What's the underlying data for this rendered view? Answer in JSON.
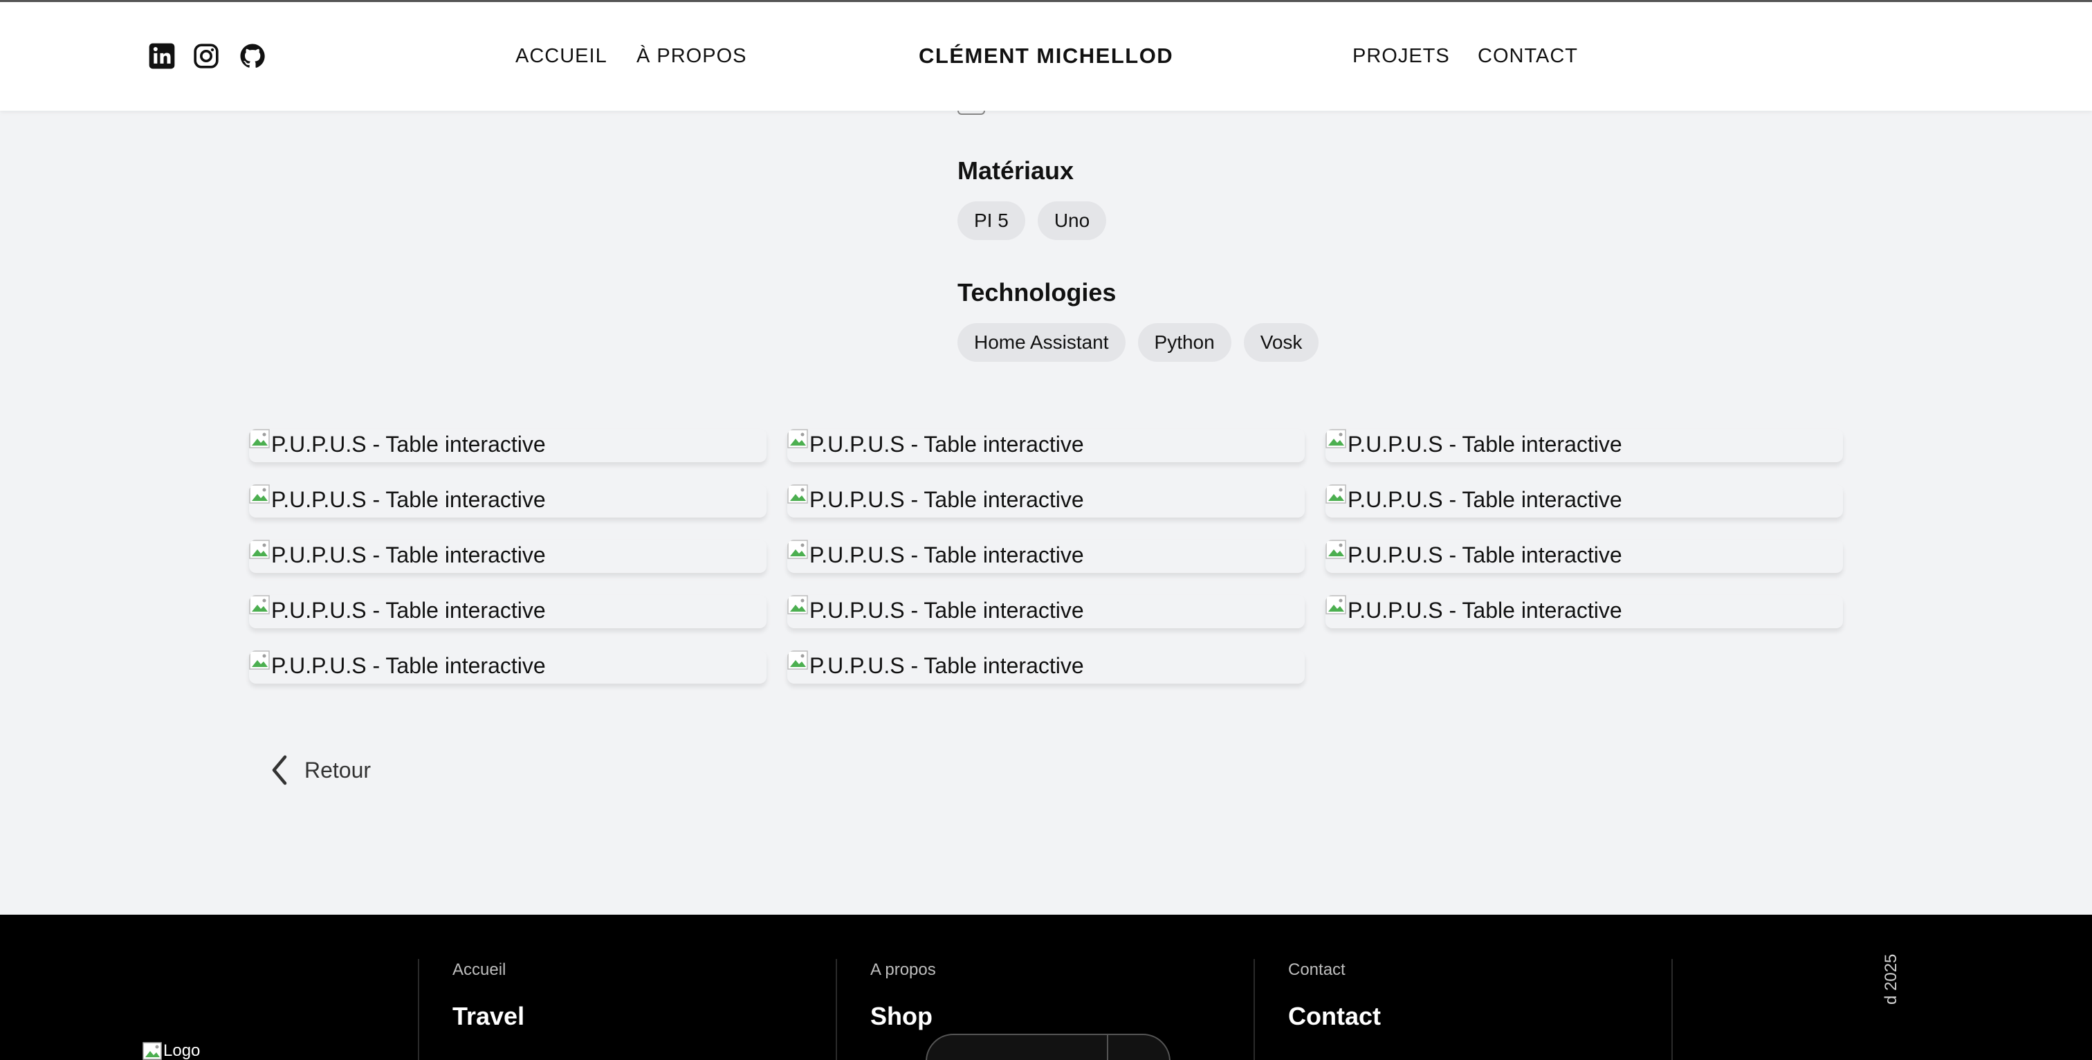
{
  "header": {
    "social": [
      {
        "name": "linkedin-icon"
      },
      {
        "name": "instagram-icon"
      },
      {
        "name": "github-icon"
      }
    ],
    "nav_left": [
      "ACCUEIL",
      "À PROPOS"
    ],
    "brand": "CLÉMENT MICHELLOD",
    "nav_right": [
      "PROJETS",
      "CONTACT"
    ]
  },
  "materials": {
    "title": "Matériaux",
    "chips": [
      "PI 5",
      "Uno"
    ]
  },
  "technologies": {
    "title": "Technologies",
    "chips": [
      "Home Assistant",
      "Python",
      "Vosk"
    ]
  },
  "gallery": {
    "items": [
      "P.U.P.U.S - Table interactive",
      "P.U.P.U.S - Table interactive",
      "P.U.P.U.S - Table interactive",
      "P.U.P.U.S - Table interactive",
      "P.U.P.U.S - Table interactive",
      "P.U.P.U.S - Table interactive",
      "P.U.P.U.S - Table interactive",
      "P.U.P.U.S - Table interactive",
      "P.U.P.U.S - Table interactive",
      "P.U.P.U.S - Table interactive",
      "P.U.P.U.S - Table interactive",
      "P.U.P.U.S - Table interactive",
      "P.U.P.U.S - Table interactive",
      "P.U.P.U.S - Table interactive"
    ]
  },
  "back": {
    "label": "Retour"
  },
  "footer": {
    "logo_alt": "Logo",
    "columns": [
      {
        "small": "Accueil",
        "big": "Travel"
      },
      {
        "small": "A propos",
        "big": "Shop"
      },
      {
        "small": "Contact",
        "big": "Contact"
      }
    ],
    "copyright_fragment": "d 2025"
  },
  "colors": {
    "page_bg": "#f2f3f5",
    "chip_bg": "#e4e5e8",
    "footer_bg": "#000000",
    "text": "#111111"
  }
}
